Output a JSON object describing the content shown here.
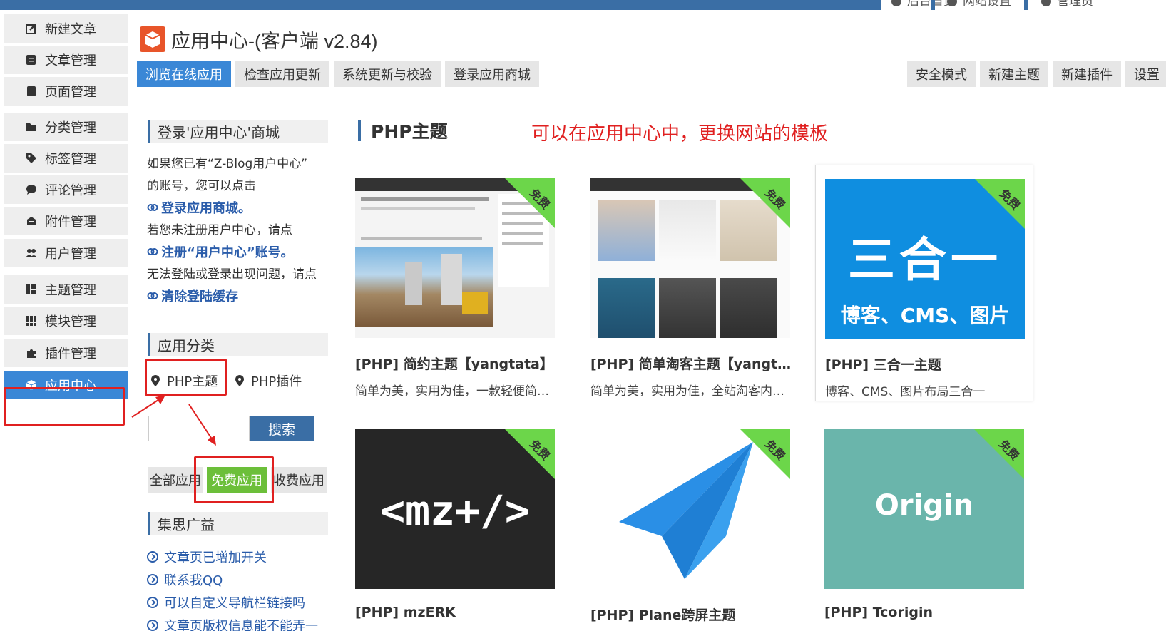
{
  "top_links": [
    "后台首页",
    "网站设置",
    "管理员"
  ],
  "sidebar": {
    "items": [
      {
        "label": "新建文章",
        "icon": "edit-icon"
      },
      {
        "label": "文章管理",
        "icon": "article-icon"
      },
      {
        "label": "页面管理",
        "icon": "page-icon"
      },
      {
        "label": "分类管理",
        "icon": "folder-icon"
      },
      {
        "label": "标签管理",
        "icon": "tag-icon"
      },
      {
        "label": "评论管理",
        "icon": "comment-icon"
      },
      {
        "label": "附件管理",
        "icon": "attachment-icon"
      },
      {
        "label": "用户管理",
        "icon": "users-icon"
      },
      {
        "label": "主题管理",
        "icon": "theme-icon"
      },
      {
        "label": "模块管理",
        "icon": "grid-icon"
      },
      {
        "label": "插件管理",
        "icon": "puzzle-icon"
      },
      {
        "label": "应用中心",
        "icon": "cube-icon"
      }
    ],
    "active": "应用中心"
  },
  "header": {
    "title": "应用中心-(客户端 v2.84)"
  },
  "tabs_left": [
    "浏览在线应用",
    "检查应用更新",
    "系统更新与校验",
    "登录应用商城"
  ],
  "tabs_right": [
    "安全模式",
    "新建主题",
    "新建插件",
    "设置"
  ],
  "login_panel": {
    "heading": "登录'应用中心'商城",
    "line1": "如果您已有“Z-Blog用户中心”",
    "line2": "的账号，您可以点击",
    "link1": "登录应用商城。",
    "line3": "若您未注册用户中心，请点",
    "link2": "注册“用户中心”账号。",
    "line4": "无法登陆或登录出现问题，请点",
    "link3": "清除登陆缓存"
  },
  "category_panel": {
    "heading": "应用分类",
    "cat1": "PHP主题",
    "cat2": "PHP插件",
    "search_button": "搜索",
    "search_value": "",
    "filter_all": "全部应用",
    "filter_free": "免费应用",
    "filter_paid": "收费应用"
  },
  "ads_panel": {
    "heading": "集思广益",
    "items": [
      "文章页已增加开关",
      "联系我QQ",
      "可以自定义导航栏链接吗",
      "文章页版权信息能不能弄一"
    ]
  },
  "main": {
    "section_title": "PHP主题",
    "note": "可以在应用中心中，更换网站的模板",
    "ribbon": "免费",
    "cards": [
      {
        "title": "[PHP] 简约主题【yangtata】",
        "desc": "简单为美，实用为佳，一款轻便简约的主题"
      },
      {
        "title": "[PHP] 简单淘客主题【yangtata】",
        "desc": "简单为美，实用为佳，全站淘客内容展示"
      },
      {
        "title": "[PHP] 三合一主题",
        "desc": "博客、CMS、图片布局三合一",
        "thumb_big": "三合一",
        "thumb_small": "博客、CMS、图片"
      },
      {
        "title": "[PHP] mzERK",
        "thumb_text": "<mz+/>"
      },
      {
        "title": "[PHP] Plane跨屏主题"
      },
      {
        "title": "[PHP] Tcorigin",
        "thumb_text": "Origin"
      }
    ]
  },
  "colors": {
    "accent": "#3a87d6",
    "topbar": "#3a6ea5",
    "highlight": "#e02020",
    "free_green": "#6cbf3a"
  }
}
